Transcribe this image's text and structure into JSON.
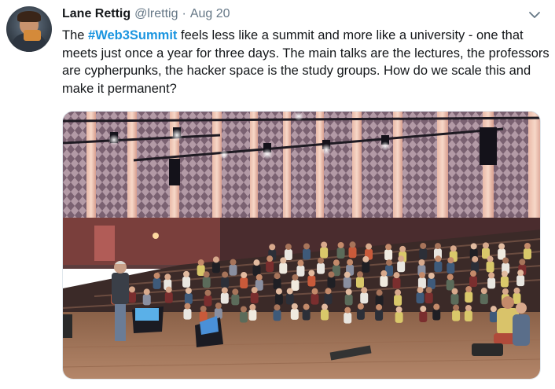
{
  "tweet": {
    "author_name": "Lane Rettig",
    "author_handle": "@lrettig",
    "separator": "·",
    "timestamp": "Aug 20",
    "hashtag": "#Web3Summit",
    "text_before_hashtag": "The ",
    "text_after_hashtag": " feels less like a summit and more like a university - one that meets just once a year for three days. The main talks are the lectures, the professors are cypherpunks, the hacker space is the study groups. How do we scale this and make it permanent?",
    "more_menu_icon": "chevron-down-icon",
    "avatar_icon": "profile-photo"
  },
  "colors": {
    "hashtag": "#1b95e0",
    "secondary_text": "#657786",
    "primary_text": "#14171a",
    "border": "#e1e8ed"
  }
}
